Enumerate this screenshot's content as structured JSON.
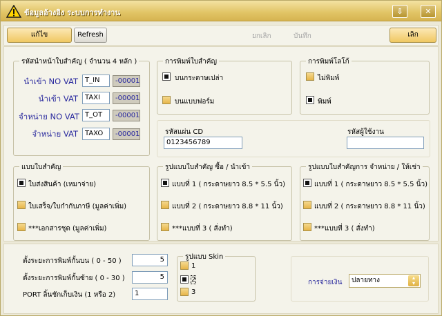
{
  "window": {
    "title": "ข้อมูลอ้างอิง ระบบการทำงาน",
    "minimize_glyph": "⇩",
    "close_glyph": "✕",
    "icon": "warning-triangle-icon"
  },
  "toolbar": {
    "edit_label": "แก้ไข",
    "refresh_label": "Refresh",
    "cancel_label": "ยกเลิก",
    "save_label": "บันทึก",
    "exit_label": "เลิก"
  },
  "prefix_group": {
    "legend": "รหัสนำหน้าใบสำคัญ ( จำนวน 4 หลัก )",
    "rows": [
      {
        "label": "นำเข้า NO VAT",
        "code": "T_IN",
        "suffix": "-00001"
      },
      {
        "label": "นำเข้า VAT",
        "code": "TAXI",
        "suffix": "-00001"
      },
      {
        "label": "จำหน่าย NO VAT",
        "code": "T_OT",
        "suffix": "-00001"
      },
      {
        "label": "จำหน่าย VAT",
        "code": "TAXO",
        "suffix": "-00001"
      }
    ]
  },
  "print_doc_group": {
    "legend": "การพิมพ์ใบสำคัญ",
    "options": [
      {
        "label": "บนกระดาษเปล่า",
        "checked": true
      },
      {
        "label": "บนแบบฟอร์ม",
        "checked": false
      }
    ]
  },
  "print_logo_group": {
    "legend": "การพิมพ์โลโก้",
    "options": [
      {
        "label": "ไม่พิมพ์",
        "checked": false
      },
      {
        "label": "พิมพ์",
        "checked": true
      }
    ]
  },
  "cd_code": {
    "label": "รหัสแผ่น CD",
    "value": "0123456789"
  },
  "user_code": {
    "label": "รหัสผู้ใช้งาน",
    "value": ""
  },
  "doc_type_group": {
    "legend": "แบบใบสำคัญ",
    "options": [
      {
        "label": "ใบส่งสินค้า (เหมาจ่าย)",
        "checked": true
      },
      {
        "label": "ใบเสร็จ/ใบกำกับภาษี (มูลค่าเพิ่ม)",
        "checked": false
      },
      {
        "label": "***เอกสารชุด (มูลค่าเพิ่ม)",
        "checked": false
      }
    ]
  },
  "buy_format_group": {
    "legend": "รูปแบบใบสำคัญ ซื้อ / นำเข้า",
    "options": [
      {
        "label": "แบบที่ 1 ( กระดาษยาว 8.5 * 5.5 นิ้ว)",
        "checked": true
      },
      {
        "label": "แบบที่ 2 ( กระดาษยาว 8.8 * 11 นิ้ว)",
        "checked": false
      },
      {
        "label": "***แบบที่ 3 ( สั่งทำ)",
        "checked": false
      }
    ]
  },
  "sell_format_group": {
    "legend": "รูปแบบใบสำคัญการ จำหน่าย  / ให้เช่า",
    "options": [
      {
        "label": "แบบที่ 1 ( กระดาษยาว 8.5 * 5.5 นิ้ว)",
        "checked": true
      },
      {
        "label": "แบบที่ 2 ( กระดาษยาว 8.8 * 11 นิ้ว)",
        "checked": false
      },
      {
        "label": "***แบบที่ 3 ( สั่งทำ)",
        "checked": false
      }
    ]
  },
  "margins": {
    "top_label": "ตั้งระยะการพิมพ์กั้นบน ( 0 - 50 )",
    "top_value": "5",
    "left_label": "ตั้งระยะการพิมพ์กั้นซ้าย ( 0 - 30 )",
    "left_value": "5",
    "port_label": "PORT ลิ้นชักเก็บเงิน (1 หรือ 2)",
    "port_value": "1"
  },
  "skin_group": {
    "legend": "รูปแบบ Skin",
    "options": [
      {
        "label": "1",
        "checked": false
      },
      {
        "label": "2",
        "checked": true
      },
      {
        "label": "3",
        "checked": false
      }
    ]
  },
  "payment": {
    "label": "การจ่ายเงิน",
    "value": "ปลายทาง"
  }
}
